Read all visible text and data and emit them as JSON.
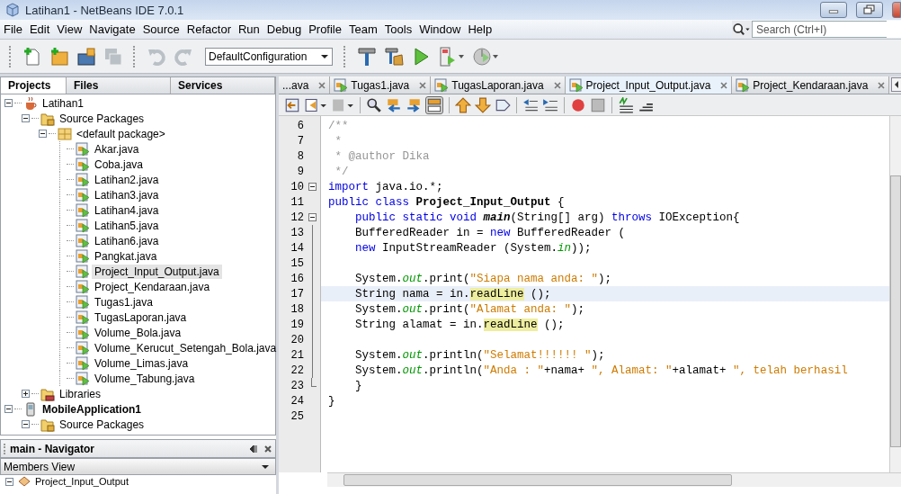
{
  "window": {
    "title": "Latihan1 - NetBeans IDE 7.0.1"
  },
  "menu_bar": [
    "File",
    "Edit",
    "View",
    "Navigate",
    "Source",
    "Refactor",
    "Run",
    "Debug",
    "Profile",
    "Team",
    "Tools",
    "Window",
    "Help"
  ],
  "search": {
    "placeholder": "Search (Ctrl+I)"
  },
  "toolbar": {
    "configuration": "DefaultConfiguration",
    "buttons": [
      {
        "kind": "new-file",
        "disabled": false
      },
      {
        "kind": "new-project",
        "disabled": false
      },
      {
        "kind": "open-project",
        "disabled": false
      },
      {
        "kind": "save-all",
        "disabled": true
      },
      {
        "kind": "undo",
        "disabled": true
      },
      {
        "kind": "redo",
        "disabled": true
      },
      {
        "kind": "build",
        "disabled": false
      },
      {
        "kind": "clean-build",
        "disabled": false
      },
      {
        "kind": "run",
        "disabled": false
      },
      {
        "kind": "debug",
        "disabled": false
      },
      {
        "kind": "profile",
        "disabled": false
      }
    ]
  },
  "side_tabs": [
    {
      "label": "Projects",
      "selected": true
    },
    {
      "label": "Files",
      "selected": false
    },
    {
      "label": "Services",
      "selected": false
    }
  ],
  "projects_tree": [
    {
      "label": "Latihan1",
      "kind": "project",
      "main": false,
      "expanded": true,
      "selected": false,
      "children": [
        {
          "label": "Source Packages",
          "kind": "source-packages",
          "expanded": true,
          "selected": false,
          "children": [
            {
              "label": "<default package>",
              "kind": "package",
              "expanded": true,
              "selected": false,
              "children": [
                {
                  "label": "Akar.java",
                  "kind": "java-file",
                  "selected": false
                },
                {
                  "label": "Coba.java",
                  "kind": "java-file",
                  "selected": false
                },
                {
                  "label": "Latihan2.java",
                  "kind": "java-file",
                  "selected": false
                },
                {
                  "label": "Latihan3.java",
                  "kind": "java-file",
                  "selected": false
                },
                {
                  "label": "Latihan4.java",
                  "kind": "java-file",
                  "selected": false
                },
                {
                  "label": "Latihan5.java",
                  "kind": "java-file",
                  "selected": false
                },
                {
                  "label": "Latihan6.java",
                  "kind": "java-file",
                  "selected": false
                },
                {
                  "label": "Pangkat.java",
                  "kind": "java-file",
                  "selected": false
                },
                {
                  "label": "Project_Input_Output.java",
                  "kind": "java-file",
                  "selected": true
                },
                {
                  "label": "Project_Kendaraan.java",
                  "kind": "java-file",
                  "selected": false
                },
                {
                  "label": "Tugas1.java",
                  "kind": "java-file",
                  "selected": false
                },
                {
                  "label": "TugasLaporan.java",
                  "kind": "java-file",
                  "selected": false
                },
                {
                  "label": "Volume_Bola.java",
                  "kind": "java-file",
                  "selected": false
                },
                {
                  "label": "Volume_Kerucut_Setengah_Bola.java",
                  "kind": "java-file",
                  "selected": false
                },
                {
                  "label": "Volume_Limas.java",
                  "kind": "java-file",
                  "selected": false
                },
                {
                  "label": "Volume_Tabung.java",
                  "kind": "java-file",
                  "selected": false
                }
              ]
            }
          ]
        },
        {
          "label": "Libraries",
          "kind": "libraries",
          "expanded": false,
          "selected": false
        }
      ]
    },
    {
      "label": "MobileApplication1",
      "kind": "mobile-project",
      "main": true,
      "expanded": true,
      "selected": false,
      "children": [
        {
          "label": "Source Packages",
          "kind": "source-packages",
          "expanded": true,
          "selected": false
        }
      ]
    }
  ],
  "navigator": {
    "title": "main - Navigator",
    "view": "Members View",
    "items": [
      {
        "label": "Project_Input_Output",
        "expanded": true
      }
    ]
  },
  "editor_tabs": [
    {
      "label": "...ava",
      "kind": "partial",
      "selected": false
    },
    {
      "label": "Tugas1.java",
      "kind": "file",
      "selected": false
    },
    {
      "label": "TugasLaporan.java",
      "kind": "file",
      "selected": false
    },
    {
      "label": "Project_Input_Output.java",
      "kind": "file",
      "selected": true
    },
    {
      "label": "Project_Kendaraan.java",
      "kind": "file",
      "selected": false
    }
  ],
  "code_lines": [
    {
      "number": "6",
      "kind": "plain",
      "current": false,
      "tokens": [
        {
          "kind": "comment",
          "text": "/**"
        }
      ]
    },
    {
      "number": "7",
      "kind": "plain",
      "current": false,
      "tokens": [
        {
          "kind": "comment",
          "text": " *"
        }
      ]
    },
    {
      "number": "8",
      "kind": "plain",
      "current": false,
      "tokens": [
        {
          "kind": "comment",
          "text": " * @author Dika"
        }
      ]
    },
    {
      "number": "9",
      "kind": "plain",
      "current": false,
      "tokens": [
        {
          "kind": "comment",
          "text": " */"
        }
      ]
    },
    {
      "number": "10",
      "kind": "fold-start",
      "current": false,
      "tokens": [
        {
          "kind": "keyword",
          "text": "import"
        },
        {
          "kind": "plain",
          "text": " java.io.*;"
        }
      ]
    },
    {
      "number": "11",
      "kind": "plain",
      "current": false,
      "tokens": [
        {
          "kind": "keyword",
          "text": "public class "
        },
        {
          "kind": "class-name",
          "text": "Project_Input_Output"
        },
        {
          "kind": "plain",
          "text": " {"
        }
      ]
    },
    {
      "number": "12",
      "kind": "fold-start",
      "current": false,
      "tokens": [
        {
          "kind": "keyword",
          "text": "    public static void "
        },
        {
          "kind": "method",
          "text": "main"
        },
        {
          "kind": "plain",
          "text": "(String[] arg) "
        },
        {
          "kind": "keyword",
          "text": "throws"
        },
        {
          "kind": "plain",
          "text": " IOException{"
        }
      ]
    },
    {
      "number": "13",
      "kind": "fold-body",
      "current": false,
      "tokens": [
        {
          "kind": "plain",
          "text": "    BufferedReader in = "
        },
        {
          "kind": "keyword",
          "text": "new"
        },
        {
          "kind": "plain",
          "text": " BufferedReader ("
        }
      ]
    },
    {
      "number": "14",
      "kind": "fold-body",
      "current": false,
      "tokens": [
        {
          "kind": "keyword",
          "text": "    new"
        },
        {
          "kind": "plain",
          "text": " InputStreamReader (System."
        },
        {
          "kind": "field",
          "text": "in"
        },
        {
          "kind": "plain",
          "text": "));"
        }
      ]
    },
    {
      "number": "15",
      "kind": "fold-body",
      "current": false
    },
    {
      "number": "16",
      "kind": "fold-body",
      "current": false,
      "tokens": [
        {
          "kind": "plain",
          "text": "    System."
        },
        {
          "kind": "field",
          "text": "out"
        },
        {
          "kind": "plain",
          "text": ".print("
        },
        {
          "kind": "string",
          "text": "\"Siapa nama anda: \""
        },
        {
          "kind": "plain",
          "text": ");"
        }
      ]
    },
    {
      "number": "17",
      "kind": "fold-body",
      "current": true,
      "tokens": [
        {
          "kind": "plain",
          "text": "    String nama = in."
        },
        {
          "kind": "mark",
          "text": "readLine"
        },
        {
          "kind": "plain",
          "text": " ();"
        }
      ]
    },
    {
      "number": "18",
      "kind": "fold-body",
      "current": false,
      "tokens": [
        {
          "kind": "plain",
          "text": "    System."
        },
        {
          "kind": "field",
          "text": "out"
        },
        {
          "kind": "plain",
          "text": ".print("
        },
        {
          "kind": "string",
          "text": "\"Alamat anda: \""
        },
        {
          "kind": "plain",
          "text": ");"
        }
      ]
    },
    {
      "number": "19",
      "kind": "fold-body",
      "current": false,
      "tokens": [
        {
          "kind": "plain",
          "text": "    String alamat = in."
        },
        {
          "kind": "mark",
          "text": "readLine"
        },
        {
          "kind": "plain",
          "text": " ();"
        }
      ]
    },
    {
      "number": "20",
      "kind": "fold-body",
      "current": false
    },
    {
      "number": "21",
      "kind": "fold-body",
      "current": false,
      "tokens": [
        {
          "kind": "plain",
          "text": "    System."
        },
        {
          "kind": "field",
          "text": "out"
        },
        {
          "kind": "plain",
          "text": ".println("
        },
        {
          "kind": "string",
          "text": "\"Selamat!!!!!! \""
        },
        {
          "kind": "plain",
          "text": ");"
        }
      ]
    },
    {
      "number": "22",
      "kind": "fold-body",
      "current": false,
      "tokens": [
        {
          "kind": "plain",
          "text": "    System."
        },
        {
          "kind": "field",
          "text": "out"
        },
        {
          "kind": "plain",
          "text": ".println("
        },
        {
          "kind": "string",
          "text": "\"Anda : \""
        },
        {
          "kind": "plain",
          "text": "+nama+ "
        },
        {
          "kind": "string",
          "text": "\", Alamat: \""
        },
        {
          "kind": "plain",
          "text": "+alamat+ "
        },
        {
          "kind": "string",
          "text": "\", telah berhasil"
        }
      ]
    },
    {
      "number": "23",
      "kind": "fold-end",
      "current": false,
      "tokens": [
        {
          "kind": "plain",
          "text": "    }"
        }
      ]
    },
    {
      "number": "24",
      "kind": "plain",
      "current": false,
      "tokens": [
        {
          "kind": "plain",
          "text": "}"
        }
      ]
    },
    {
      "number": "25",
      "kind": "plain",
      "current": false
    }
  ]
}
